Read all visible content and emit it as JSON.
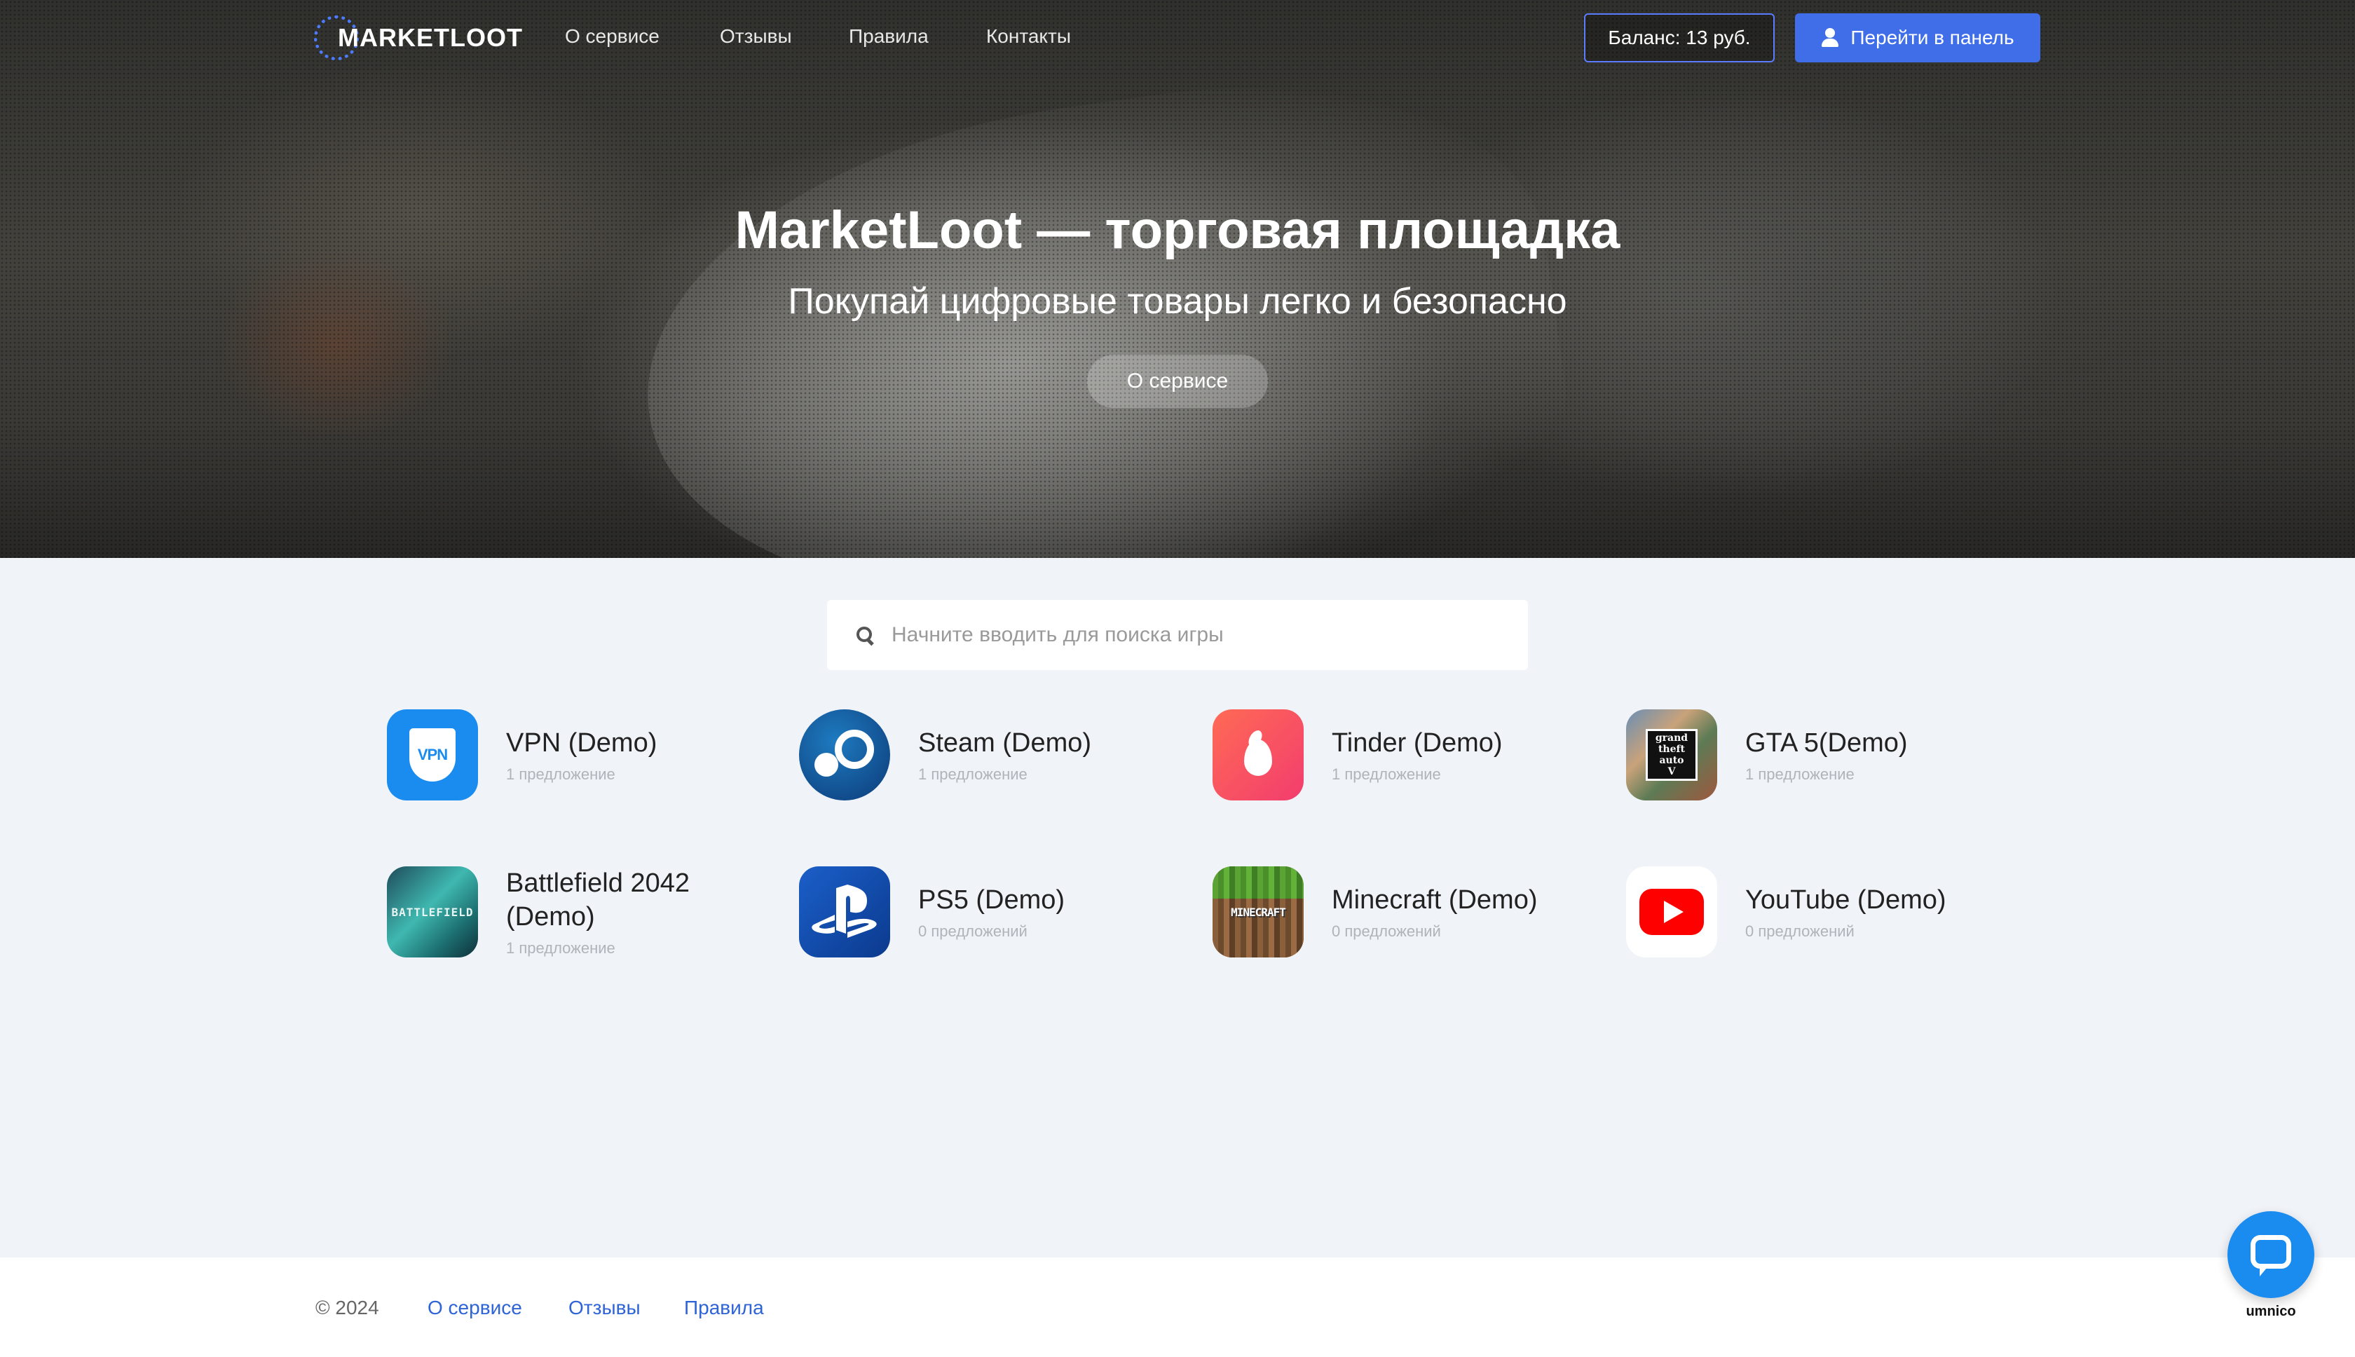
{
  "nav": {
    "logo": "MARKETLOOT",
    "links": [
      "О сервисе",
      "Отзывы",
      "Правила",
      "Контакты"
    ],
    "balance": "Баланс: 13 руб.",
    "panel_button": "Перейти в панель"
  },
  "hero": {
    "title": "MarketLoot — торговая площадка",
    "subtitle": "Покупай цифровые товары легко и безопасно",
    "button": "О сервисе"
  },
  "search": {
    "placeholder": "Начните вводить для поиска игры"
  },
  "games": [
    {
      "name": "VPN (Demo)",
      "count": "1 предложение",
      "icon": "vpn-icon"
    },
    {
      "name": "Steam (Demo)",
      "count": "1 предложение",
      "icon": "steam-icon"
    },
    {
      "name": "Tinder (Demo)",
      "count": "1 предложение",
      "icon": "tinder-icon"
    },
    {
      "name": "GTA 5(Demo)",
      "count": "1 предложение",
      "icon": "gta5-icon"
    },
    {
      "name": "Battlefield 2042 (Demo)",
      "count": "1 предложение",
      "icon": "battlefield-icon"
    },
    {
      "name": "PS5 (Demo)",
      "count": "0 предложений",
      "icon": "ps5-icon"
    },
    {
      "name": "Minecraft (Demo)",
      "count": "0 предложений",
      "icon": "minecraft-icon"
    },
    {
      "name": "YouTube (Demo)",
      "count": "0 предложений",
      "icon": "youtube-icon"
    }
  ],
  "icon_text": {
    "vpn": "VPN",
    "gta": [
      "grand",
      "theft",
      "auto",
      "V"
    ],
    "battlefield": "BATTLEFIELD",
    "minecraft": "MINECRAFT"
  },
  "footer": {
    "copyright": "© 2024",
    "links": [
      "О сервисе",
      "Отзывы",
      "Правила"
    ]
  },
  "chat_widget": {
    "label": "umnico",
    "icon": "chat-bubble-icon"
  },
  "colors": {
    "accent": "#3f6ee8",
    "link": "#2f64d6",
    "chat": "#1a8cf0"
  }
}
